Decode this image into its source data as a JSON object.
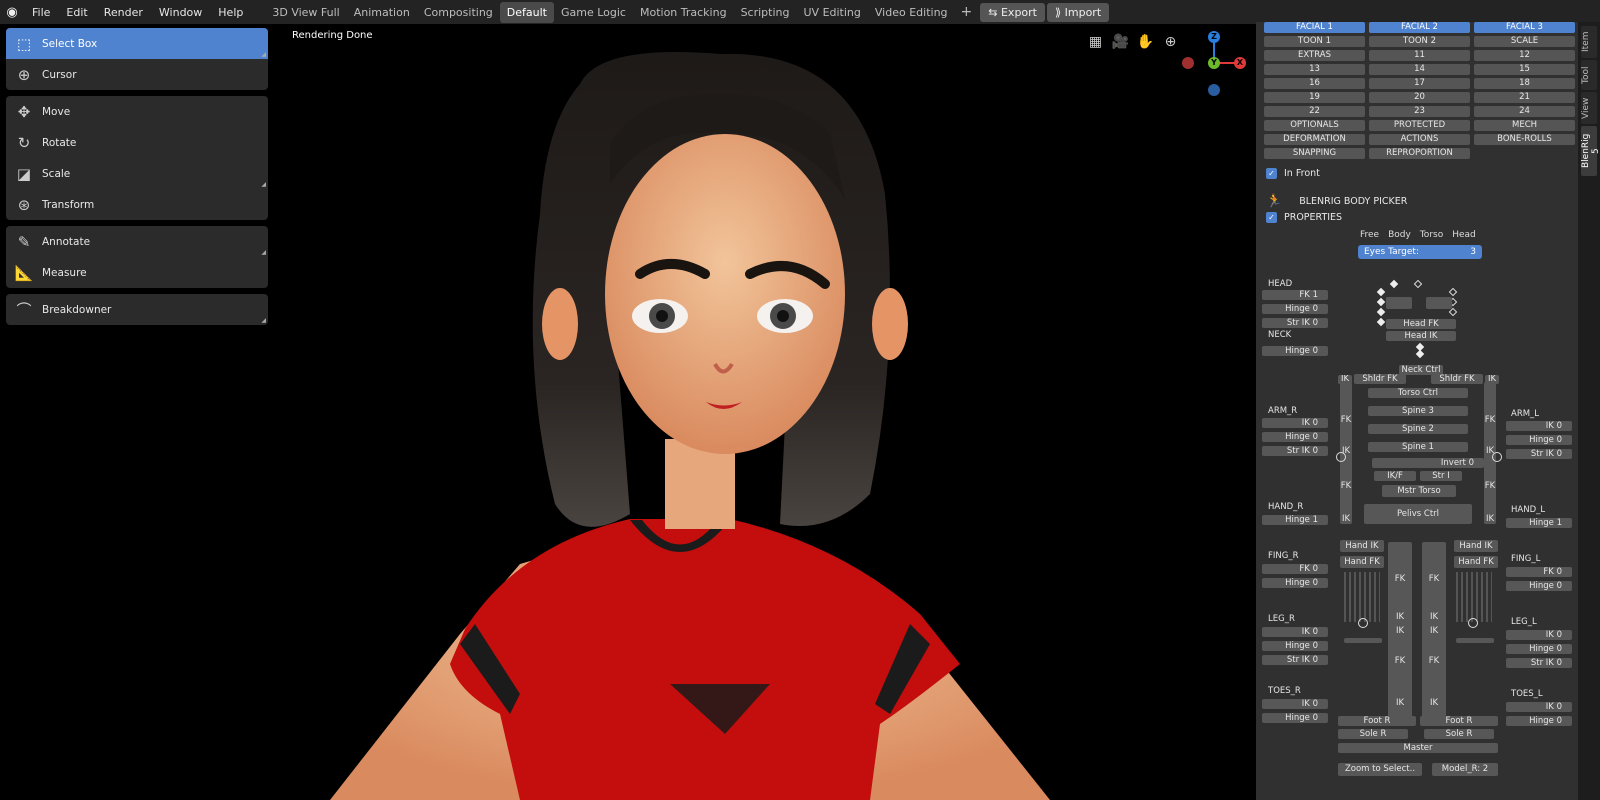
{
  "menu": {
    "items": [
      "File",
      "Edit",
      "Render",
      "Window",
      "Help"
    ]
  },
  "workspaces": {
    "tabs": [
      "3D View Full",
      "Animation",
      "Compositing",
      "Default",
      "Game Logic",
      "Motion Tracking",
      "Scripting",
      "UV Editing",
      "Video Editing"
    ],
    "active": "Default",
    "add": "+"
  },
  "header_buttons": {
    "export": "Export",
    "import": "Import"
  },
  "toolbar": {
    "groups": [
      [
        {
          "label": "Select Box",
          "icon": "select-box-icon",
          "active": true
        },
        {
          "label": "Cursor",
          "icon": "cursor-icon"
        }
      ],
      [
        {
          "label": "Move",
          "icon": "move-icon"
        },
        {
          "label": "Rotate",
          "icon": "rotate-icon"
        },
        {
          "label": "Scale",
          "icon": "scale-icon"
        },
        {
          "label": "Transform",
          "icon": "transform-icon"
        }
      ],
      [
        {
          "label": "Annotate",
          "icon": "annotate-icon"
        },
        {
          "label": "Measure",
          "icon": "measure-icon"
        }
      ],
      [
        {
          "label": "Breakdowner",
          "icon": "breakdowner-icon"
        }
      ]
    ]
  },
  "viewport": {
    "status": "Rendering Done",
    "gizmo": {
      "x": "X",
      "y": "Y",
      "z": "Z"
    }
  },
  "side_tabs": [
    "Item",
    "Tool",
    "View",
    "BlenRig 5"
  ],
  "layers": [
    [
      "FACIAL 1",
      "FACIAL 2",
      "FACIAL 3"
    ],
    [
      "TOON 1",
      "TOON 2",
      "SCALE"
    ],
    [
      "EXTRAS",
      "11",
      "12"
    ],
    [
      "13",
      "14",
      "15"
    ],
    [
      "16",
      "17",
      "18"
    ],
    [
      "19",
      "20",
      "21"
    ],
    [
      "22",
      "23",
      "24"
    ],
    [
      "OPTIONALS",
      "PROTECTED",
      "MECH"
    ],
    [
      "DEFORMATION",
      "ACTIONS",
      "BONE-ROLLS"
    ],
    [
      "SNAPPING",
      "REPROPORTION"
    ]
  ],
  "options": {
    "in_front": "In Front",
    "body_picker": "BLENRIG BODY PICKER",
    "properties": "PROPERTIES"
  },
  "props": {
    "modes": [
      "Free",
      "Body",
      "Torso",
      "Head"
    ],
    "eyes_target_label": "Eyes Target:",
    "eyes_target_value": "3"
  },
  "picker": {
    "head": "HEAD",
    "fk1": "FK 1",
    "hinge0": "Hinge 0",
    "strik0": "Str IK 0",
    "neck": "NECK",
    "head_fk": "Head FK",
    "head_ik": "Head IK",
    "neck_ctrl": "Neck Ctrl",
    "ik": "IK",
    "shldr_fk": "Shldr FK",
    "torso_ctrl": "Torso Ctrl",
    "spine3": "Spine 3",
    "spine2": "Spine 2",
    "spine1": "Spine 1",
    "invert": "Invert 0",
    "ikf": "IK/F",
    "str_i": "Str I",
    "mstr_torso": "Mstr Torso",
    "pelvis": "Pelivs Ctrl",
    "arm_r": "ARM_R",
    "arm_l": "ARM_L",
    "ik0": "IK 0",
    "hand_r": "HAND_R",
    "hand_l": "HAND_L",
    "hinge1": "Hinge 1",
    "fk": "FK",
    "hand_ik": "Hand IK",
    "hand_fk": "Hand FK",
    "fing_r": "FING_R",
    "fing_l": "FING_L",
    "fk0": "FK 0",
    "leg_r": "LEG_R",
    "leg_l": "LEG_L",
    "toes_r": "TOES_R",
    "toes_l": "TOES_L",
    "foot_r": "Foot R",
    "sole_r": "Sole R",
    "master": "Master",
    "zoom": "Zoom to Select..",
    "model": "Model_R: 2"
  }
}
